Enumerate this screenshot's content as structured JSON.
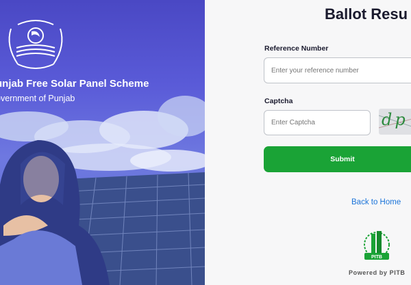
{
  "left_panel": {
    "scheme_title": "unjab Free Solar Panel Scheme",
    "government": "overnment of Punjab",
    "emblem_icon": "punjab-emblem-icon"
  },
  "form": {
    "heading": "Ballot Resu",
    "reference_label": "Reference Number",
    "reference_placeholder": "Enter your reference number",
    "captcha_label": "Captcha",
    "captcha_placeholder": "Enter Captcha",
    "captcha_text": "dp",
    "submit_label": "Submit",
    "back_link": "Back to Home"
  },
  "footer": {
    "logo_text": "PITB",
    "powered_by": "Powered by PITB"
  },
  "colors": {
    "accent_green": "#1aa336",
    "link_blue": "#1a73d9",
    "panel_purple": "#4a48c4"
  }
}
